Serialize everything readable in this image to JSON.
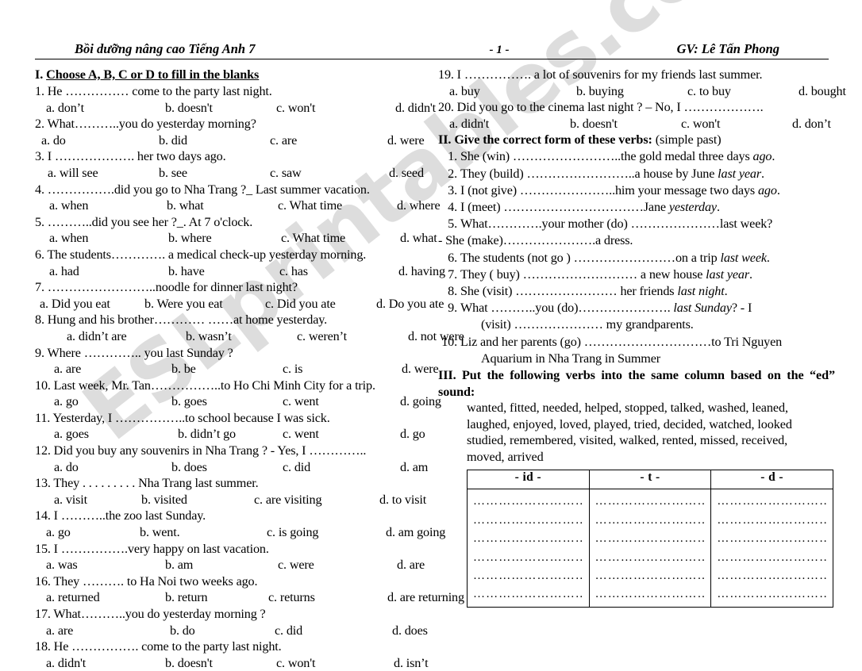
{
  "watermark": {
    "text": "ESLprintables.com"
  },
  "running_head": {
    "left": "Bồi dưỡng nâng cao Tiếng Anh 7",
    "page": "- 1 -",
    "right": "GV: Lê Tấn Phong"
  },
  "section_1": {
    "number": "I.",
    "title": "Choose A, B, C or D to fill in the blanks",
    "questions": [
      {
        "stem": "1. He …………… come to the party last night.",
        "options": [
          "a.   don’t",
          "b. doesn't",
          "c. won't",
          "d. didn't"
        ]
      },
      {
        "stem": "2. What………..you do yesterday morning?",
        "options": [
          "a.  do",
          "b.  did",
          "c.  are",
          "d.  were"
        ]
      },
      {
        "stem": "3. I ………………. her two days ago.",
        "options": [
          "a. will see",
          "b.  see",
          "c.  saw",
          "d.  seed"
        ]
      },
      {
        "stem": "4. …………….did you go to Nha Trang ?_ Last summer vacation.",
        "options": [
          "a.  when",
          "b.  what",
          "c. What time",
          "d.  where"
        ]
      },
      {
        "stem": "5. ………..did you see her ?_. At 7 o'clock.",
        "options": [
          "a.  when",
          "b.  where",
          "c.  What time",
          "d.  what"
        ]
      },
      {
        "stem": "6. The students…………. a medical check-up yesterday morning.",
        "options": [
          "a.  had",
          "b.  have",
          "c.  has",
          "d.  having"
        ]
      },
      {
        "stem": "7. ……………………..noodle for dinner last night?",
        "options": [
          "a. Did you eat",
          "b. Were you eat",
          "c. Did you ate",
          "d. Do you ate"
        ]
      },
      {
        "stem": "8. Hung and his brother………… ……at home yesterday.",
        "options": [
          "a. didn’t are",
          "b. wasn’t",
          "c. weren’t",
          "d. not were"
        ]
      },
      {
        "stem": "9. Where ………….. you last Sunday ?",
        "options": [
          "a. are",
          "b. be",
          "c. is",
          "d. were"
        ]
      },
      {
        "stem": "10. Last week, Mr. Tan……………..to Ho Chi Minh City for a trip.",
        "options": [
          "a. go",
          "b. goes",
          "c. went",
          "d. going"
        ]
      },
      {
        "stem": "11. Yesterday, I ……………..to school because I was sick.",
        "options": [
          "a. goes",
          "b. didn’t go",
          "c. went",
          "d. go"
        ]
      },
      {
        "stem": "12. Did you buy any souvenirs in Nha Trang ? -  Yes, I …………..",
        "options": [
          "a. do",
          "b. does",
          "c. did",
          "d. am"
        ]
      },
      {
        "stem": "13. They . . . . . . . . .   Nha Trang last summer.",
        "options": [
          "a. visit",
          "b. visited",
          "c. are visiting",
          "d. to visit"
        ]
      },
      {
        "stem": "14. I ………..the zoo last Sunday.",
        "options": [
          "a. go",
          "b. went.",
          "c. is going",
          "d. am going"
        ]
      },
      {
        "stem": "15. I …………….very happy on last vacation.",
        "options": [
          "a. was",
          "b. am",
          "c. were",
          "d. are"
        ]
      },
      {
        "stem": "16. They ………. to Ha Noi two weeks ago.",
        "options": [
          "a. returned",
          "b. return",
          "c. returns",
          "d. are returning"
        ]
      },
      {
        "stem": "17. What………..you do yesterday morning ?",
        "options": [
          "a. are",
          "b. do",
          "c. did",
          "d. does"
        ]
      },
      {
        "stem": "18. He ……………. come to the party last night.",
        "options": [
          "a. didn't",
          "b. doesn't",
          "c. won't",
          "d. isn’t"
        ]
      },
      {
        "stem": "19. I ……………. a lot of souvenirs for my friends last summer.",
        "options": [
          "a. buy",
          "b. buying",
          "c. to buy",
          "d. bought"
        ]
      },
      {
        "stem": "20. Did you go to the cinema last night ? – No, I ……………….",
        "options": [
          "a. didn't",
          "b. doesn't",
          "c. won't",
          "d. don’t"
        ]
      }
    ]
  },
  "section_2": {
    "number": "II.",
    "title": "Give the correct form of these verbs:",
    "note": "(simple past)",
    "items": [
      {
        "num": "1.",
        "pre": "She (win) ……………………..the gold medal three days ",
        "em": "ago",
        "post": "."
      },
      {
        "num": "2.",
        "pre": "They (build) ……………………..a house by June ",
        "em": "last year",
        "post": "."
      },
      {
        "num": "3.",
        "pre": "I (not give) …………………..him your message two days ",
        "em": "ago",
        "post": "."
      },
      {
        "num": "4.",
        "pre": "I (meet) ……………………………Jane ",
        "em": "yesterday",
        "post": "."
      },
      {
        "num": "5.",
        "pre": "What………….your mother (do) …………………last week?",
        "em": "",
        "post": ""
      },
      {
        "num": "",
        "pre": "- She (make)………………….a dress.",
        "em": "",
        "post": "",
        "nohang": true
      },
      {
        "num": "6.",
        "pre": "The students (not go ) ……………………on a trip ",
        "em": "last week",
        "post": "."
      },
      {
        "num": "7.",
        "pre": "They ( buy)  ……………………… a new house ",
        "em": "last year",
        "post": "."
      },
      {
        "num": "8.",
        "pre": "She (visit) …………………… her friends ",
        "em": "last night",
        "post": "."
      },
      {
        "num": "9.",
        "pre": "What  ………..you (do)…………………. ",
        "em": "last  Sunday",
        "post": "?  -  I"
      },
      {
        "num": "",
        "pre": "(visit) ………………… my grandparents.",
        "em": "",
        "post": "",
        "cont": true
      },
      {
        "num": "10.",
        "pre": "Liz  and  her  parents  (go)  …………………………to Tri Nguyen",
        "em": "",
        "post": ""
      },
      {
        "num": "",
        "pre": "Aquarium in Nha Trang in Summer",
        "em": "",
        "post": "",
        "cont": true
      }
    ]
  },
  "section_3": {
    "number": "III.",
    "title": "Put the following verbs into the same column based on the “ed” sound:",
    "verb_bank": [
      "wanted, fitted, needed, helped, stopped, talked, washed, leaned,",
      "laughed, enjoyed, loved, played, tried, decided, watched, looked",
      "studied, remembered, visited, walked, rented, missed, received,",
      "moved, arrived"
    ],
    "table": {
      "headers": [
        "- id -",
        "- t -",
        "- d -"
      ],
      "row_count": 6,
      "dot_fill": "……………………………"
    }
  }
}
